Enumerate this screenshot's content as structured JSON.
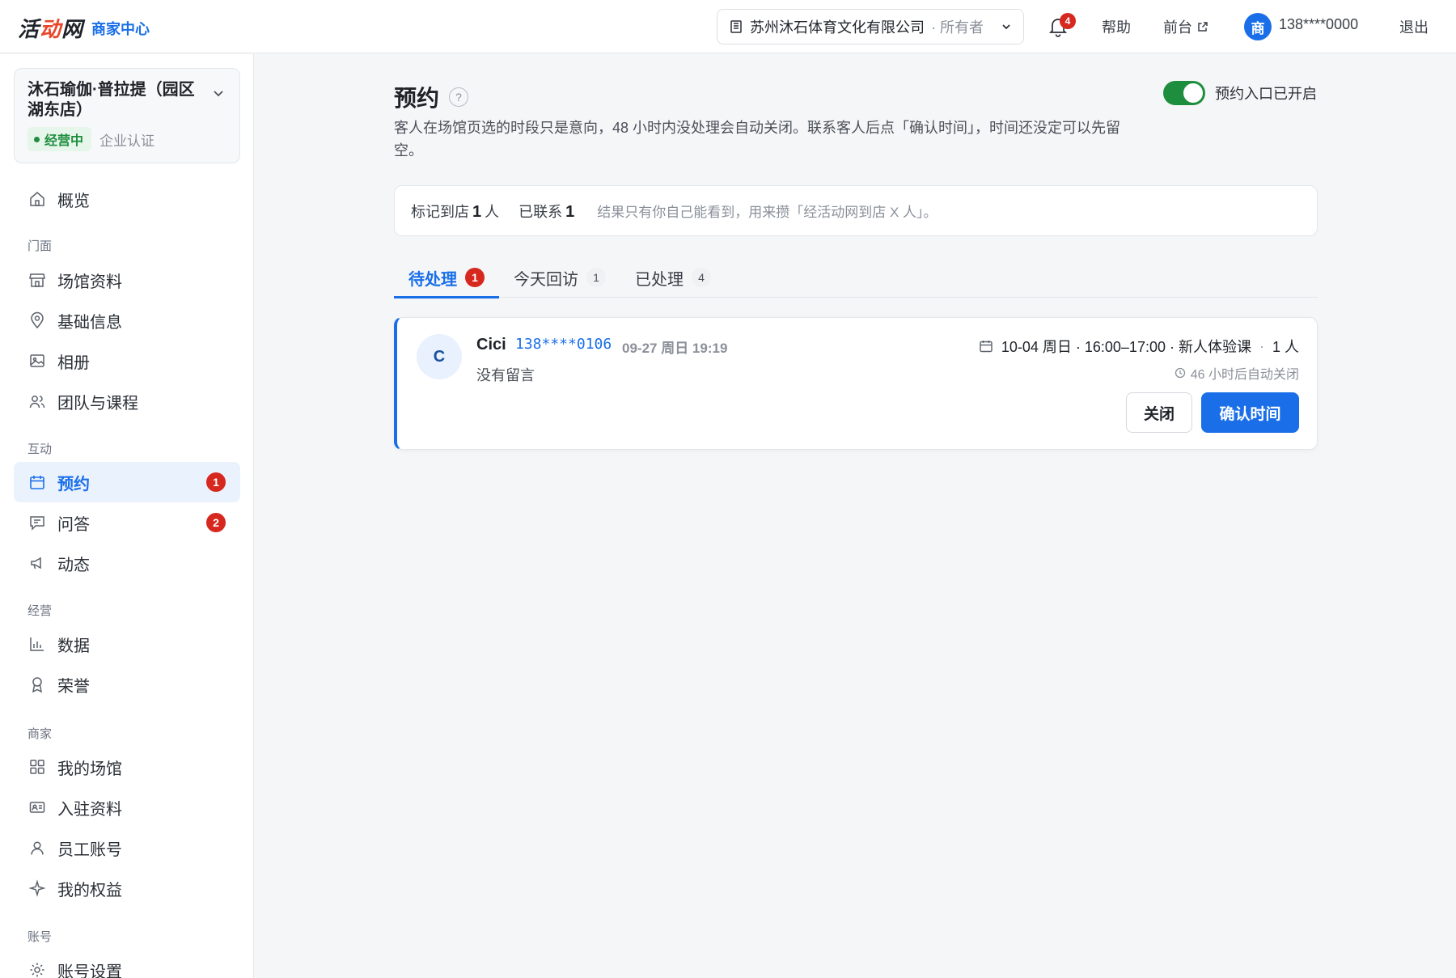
{
  "header": {
    "logo_text_a": "活",
    "logo_text_b": "动",
    "logo_text_c": "网",
    "logo_sub": "商家中心",
    "company_name": "苏州沐石体育文化有限公司",
    "company_role": "· 所有者",
    "notification_count": "4",
    "help": "帮助",
    "frontdesk": "前台",
    "avatar_char": "商",
    "phone": "138****0000",
    "logout": "退出"
  },
  "sidebar": {
    "shop_name": "沐石瑜伽·普拉提（园区湖东店）",
    "status": "经营中",
    "cert": "企业认证",
    "overview": "概览",
    "sections": {
      "storefront": "门面",
      "interaction": "互动",
      "operation": "经营",
      "merchant": "商家",
      "account": "账号"
    },
    "items": {
      "venue_info": "场馆资料",
      "basic_info": "基础信息",
      "album": "相册",
      "team": "团队与课程",
      "booking": "预约",
      "booking_badge": "1",
      "qa": "问答",
      "qa_badge": "2",
      "feed": "动态",
      "data": "数据",
      "honor": "荣誉",
      "my_venues": "我的场馆",
      "join_info": "入驻资料",
      "staff": "员工账号",
      "benefits": "我的权益",
      "account_settings": "账号设置"
    }
  },
  "main": {
    "title": "预约",
    "help_mark": "?",
    "description": "客人在场馆页选的时段只是意向，48 小时内没处理会自动关闭。联系客人后点「确认时间」，时间还没定可以先留空。",
    "toggle_label": "预约入口已开启",
    "stats": {
      "arrived_label": "标记到店",
      "arrived_value": "1",
      "arrived_unit": "人",
      "contacted_label": "已联系",
      "contacted_value": "1",
      "note": "结果只有你自己能看到，用来攒「经活动网到店 X 人」。"
    },
    "tabs": [
      {
        "label": "待处理",
        "count": "1"
      },
      {
        "label": "今天回访",
        "count": "1"
      },
      {
        "label": "已处理",
        "count": "4"
      }
    ],
    "booking": {
      "avatar": "C",
      "name": "Cici",
      "phone": "138****0106",
      "created": "09-27 周日 19:19",
      "message": "没有留言",
      "slot_date": "10-04 周日 · 16:00–17:00 · 新人体验课",
      "slot_people": "1 人",
      "slot_sep": "·",
      "auto_close": "46 小时后自动关闭",
      "close_btn": "关闭",
      "confirm_btn": "确认时间"
    }
  },
  "colors": {
    "accent": "#1a6fe8",
    "danger": "#d6281f",
    "success": "#1e8e3e"
  }
}
